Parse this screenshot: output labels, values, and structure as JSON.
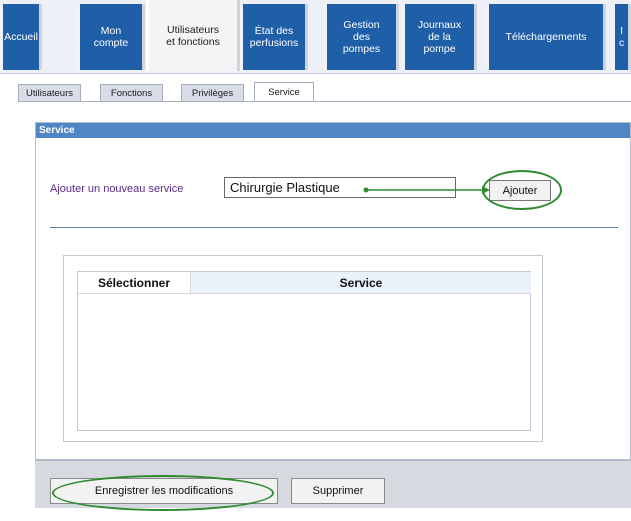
{
  "top_tabs": [
    {
      "label": "Accueil"
    },
    {
      "label": "Mon\ncompte"
    },
    {
      "label": "Utilisateurs\net fonctions"
    },
    {
      "label": "État des\nperfusions"
    },
    {
      "label": "Gestion\ndes\npompes"
    },
    {
      "label": "Journaux\nde la\npompe"
    },
    {
      "label": "Téléchargements"
    },
    {
      "label": "I\nc"
    }
  ],
  "sub_tabs": [
    {
      "label": "Utilisateurs"
    },
    {
      "label": "Fonctions"
    },
    {
      "label": "Privilèges"
    },
    {
      "label": "Service"
    }
  ],
  "panel": {
    "title": "Service"
  },
  "add_service": {
    "label": "Ajouter un nouveau service",
    "input_value": "Chirurgie Plastique",
    "button_label": "Ajouter"
  },
  "table": {
    "columns": [
      "Sélectionner",
      "Service"
    ],
    "rows": []
  },
  "footer": {
    "save_label": "Enregistrer les modifications",
    "delete_label": "Supprimer"
  },
  "colors": {
    "tab_blue": "#1f5fa8",
    "panel_header": "#4f86c6",
    "highlight_green": "#2e8b2e",
    "label_purple": "#5b2a86"
  }
}
